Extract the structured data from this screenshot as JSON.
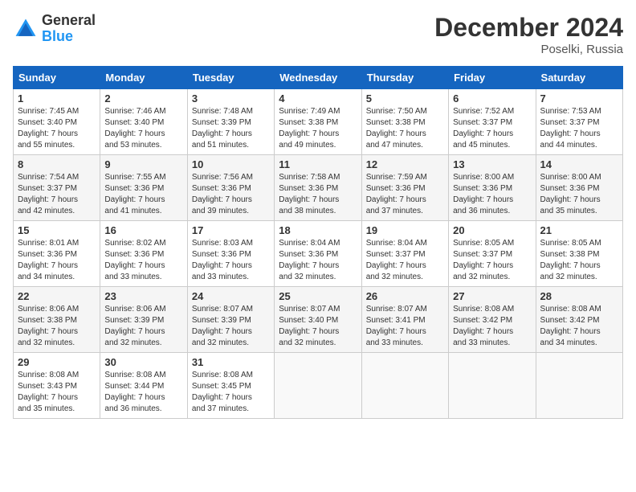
{
  "header": {
    "logo_line1": "General",
    "logo_line2": "Blue",
    "month": "December 2024",
    "location": "Poselki, Russia"
  },
  "weekdays": [
    "Sunday",
    "Monday",
    "Tuesday",
    "Wednesday",
    "Thursday",
    "Friday",
    "Saturday"
  ],
  "weeks": [
    [
      {
        "day": 1,
        "sunrise": "7:45 AM",
        "sunset": "3:40 PM",
        "daylight": "7 hours and 55 minutes."
      },
      {
        "day": 2,
        "sunrise": "7:46 AM",
        "sunset": "3:40 PM",
        "daylight": "7 hours and 53 minutes."
      },
      {
        "day": 3,
        "sunrise": "7:48 AM",
        "sunset": "3:39 PM",
        "daylight": "7 hours and 51 minutes."
      },
      {
        "day": 4,
        "sunrise": "7:49 AM",
        "sunset": "3:38 PM",
        "daylight": "7 hours and 49 minutes."
      },
      {
        "day": 5,
        "sunrise": "7:50 AM",
        "sunset": "3:38 PM",
        "daylight": "7 hours and 47 minutes."
      },
      {
        "day": 6,
        "sunrise": "7:52 AM",
        "sunset": "3:37 PM",
        "daylight": "7 hours and 45 minutes."
      },
      {
        "day": 7,
        "sunrise": "7:53 AM",
        "sunset": "3:37 PM",
        "daylight": "7 hours and 44 minutes."
      }
    ],
    [
      {
        "day": 8,
        "sunrise": "7:54 AM",
        "sunset": "3:37 PM",
        "daylight": "7 hours and 42 minutes."
      },
      {
        "day": 9,
        "sunrise": "7:55 AM",
        "sunset": "3:36 PM",
        "daylight": "7 hours and 41 minutes."
      },
      {
        "day": 10,
        "sunrise": "7:56 AM",
        "sunset": "3:36 PM",
        "daylight": "7 hours and 39 minutes."
      },
      {
        "day": 11,
        "sunrise": "7:58 AM",
        "sunset": "3:36 PM",
        "daylight": "7 hours and 38 minutes."
      },
      {
        "day": 12,
        "sunrise": "7:59 AM",
        "sunset": "3:36 PM",
        "daylight": "7 hours and 37 minutes."
      },
      {
        "day": 13,
        "sunrise": "8:00 AM",
        "sunset": "3:36 PM",
        "daylight": "7 hours and 36 minutes."
      },
      {
        "day": 14,
        "sunrise": "8:00 AM",
        "sunset": "3:36 PM",
        "daylight": "7 hours and 35 minutes."
      }
    ],
    [
      {
        "day": 15,
        "sunrise": "8:01 AM",
        "sunset": "3:36 PM",
        "daylight": "7 hours and 34 minutes."
      },
      {
        "day": 16,
        "sunrise": "8:02 AM",
        "sunset": "3:36 PM",
        "daylight": "7 hours and 33 minutes."
      },
      {
        "day": 17,
        "sunrise": "8:03 AM",
        "sunset": "3:36 PM",
        "daylight": "7 hours and 33 minutes."
      },
      {
        "day": 18,
        "sunrise": "8:04 AM",
        "sunset": "3:36 PM",
        "daylight": "7 hours and 32 minutes."
      },
      {
        "day": 19,
        "sunrise": "8:04 AM",
        "sunset": "3:37 PM",
        "daylight": "7 hours and 32 minutes."
      },
      {
        "day": 20,
        "sunrise": "8:05 AM",
        "sunset": "3:37 PM",
        "daylight": "7 hours and 32 minutes."
      },
      {
        "day": 21,
        "sunrise": "8:05 AM",
        "sunset": "3:38 PM",
        "daylight": "7 hours and 32 minutes."
      }
    ],
    [
      {
        "day": 22,
        "sunrise": "8:06 AM",
        "sunset": "3:38 PM",
        "daylight": "7 hours and 32 minutes."
      },
      {
        "day": 23,
        "sunrise": "8:06 AM",
        "sunset": "3:39 PM",
        "daylight": "7 hours and 32 minutes."
      },
      {
        "day": 24,
        "sunrise": "8:07 AM",
        "sunset": "3:39 PM",
        "daylight": "7 hours and 32 minutes."
      },
      {
        "day": 25,
        "sunrise": "8:07 AM",
        "sunset": "3:40 PM",
        "daylight": "7 hours and 32 minutes."
      },
      {
        "day": 26,
        "sunrise": "8:07 AM",
        "sunset": "3:41 PM",
        "daylight": "7 hours and 33 minutes."
      },
      {
        "day": 27,
        "sunrise": "8:08 AM",
        "sunset": "3:42 PM",
        "daylight": "7 hours and 33 minutes."
      },
      {
        "day": 28,
        "sunrise": "8:08 AM",
        "sunset": "3:42 PM",
        "daylight": "7 hours and 34 minutes."
      }
    ],
    [
      {
        "day": 29,
        "sunrise": "8:08 AM",
        "sunset": "3:43 PM",
        "daylight": "7 hours and 35 minutes."
      },
      {
        "day": 30,
        "sunrise": "8:08 AM",
        "sunset": "3:44 PM",
        "daylight": "7 hours and 36 minutes."
      },
      {
        "day": 31,
        "sunrise": "8:08 AM",
        "sunset": "3:45 PM",
        "daylight": "7 hours and 37 minutes."
      },
      null,
      null,
      null,
      null
    ]
  ]
}
